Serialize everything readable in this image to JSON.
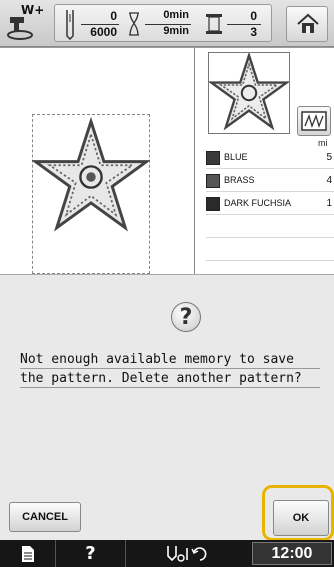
{
  "topbar": {
    "presser_foot_label": "W+",
    "stitch_count_current": "0",
    "stitch_count_total": "6000",
    "time_current": "0min",
    "time_total": "9min",
    "color_current": "0",
    "color_total": "3"
  },
  "embroidery": {
    "time_header": "mi",
    "colors": [
      {
        "name": "BLUE",
        "time": "5",
        "color": "#3a3a3a"
      },
      {
        "name": "BRASS",
        "time": "4",
        "color": "#555555"
      },
      {
        "name": "DARK FUCHSIA",
        "time": "1",
        "color": "#2a2a2a"
      }
    ]
  },
  "dialog": {
    "message_line1": "Not enough available memory to save",
    "message_line2": "the pattern. Delete another pattern?",
    "cancel_label": "CANCEL",
    "ok_label": "OK"
  },
  "bottombar": {
    "clock": "12:00"
  },
  "colors": {
    "highlight": "#e8b400",
    "dialog_bg": "#e9e9e9",
    "bottom_bg": "#161616"
  }
}
